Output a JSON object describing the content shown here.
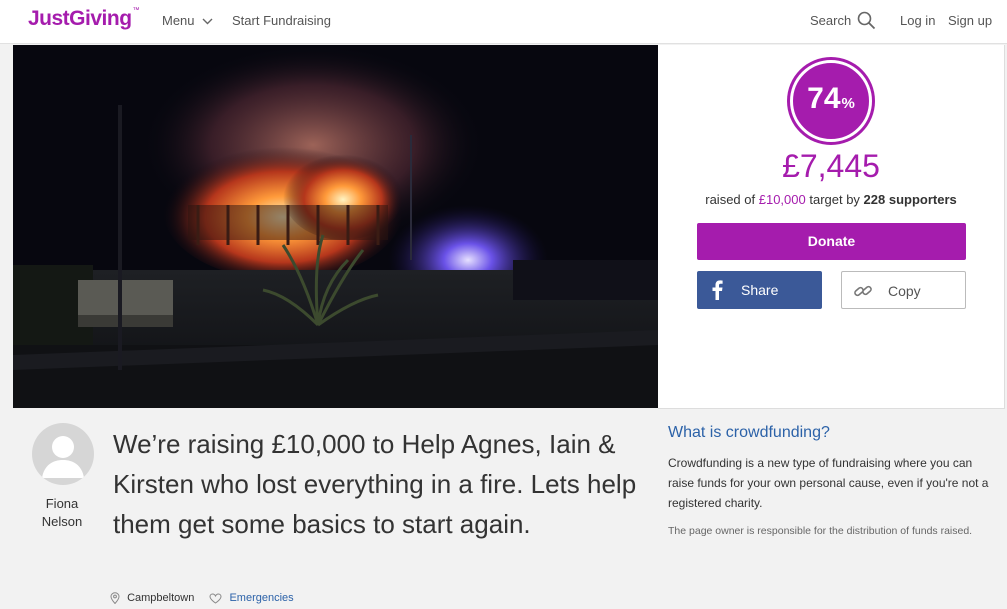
{
  "nav": {
    "logo": "JustGiving",
    "menu": "Menu",
    "start": "Start Fundraising",
    "search": "Search",
    "login": "Log in",
    "signup": "Sign up"
  },
  "fundraiser": {
    "percent": "74",
    "percent_sign": "%",
    "progress_fraction": 0.7445,
    "raised": "£7,445",
    "raised_prefix": "raised of ",
    "target": "£10,000",
    "target_mid": " target by ",
    "supporters": "228 supporters",
    "donate": "Donate",
    "share": "Share",
    "copy": "Copy"
  },
  "owner": {
    "first": "Fiona",
    "last": "Nelson"
  },
  "headline": "We’re raising £10,000 to Help Agnes, Iain & Kirsten who lost everything in a fire. Lets help them get some basics to start again.",
  "meta": {
    "location": "Campbeltown",
    "category": "Emergencies"
  },
  "crowdfunding": {
    "title": "What is crowdfunding?",
    "text": "Crowdfunding is a new type of fundraising where you can raise funds for your own personal cause, even if you're not a registered charity.",
    "note": "The page owner is responsible for the distribution of funds raised."
  },
  "colors": {
    "brand": "#a51cad",
    "facebook": "#3b5998",
    "link": "#2c62a8"
  },
  "icons": [
    "chevron-down-icon",
    "search-icon",
    "facebook-icon",
    "link-icon",
    "location-pin-icon",
    "heart-icon",
    "user-avatar-icon"
  ]
}
